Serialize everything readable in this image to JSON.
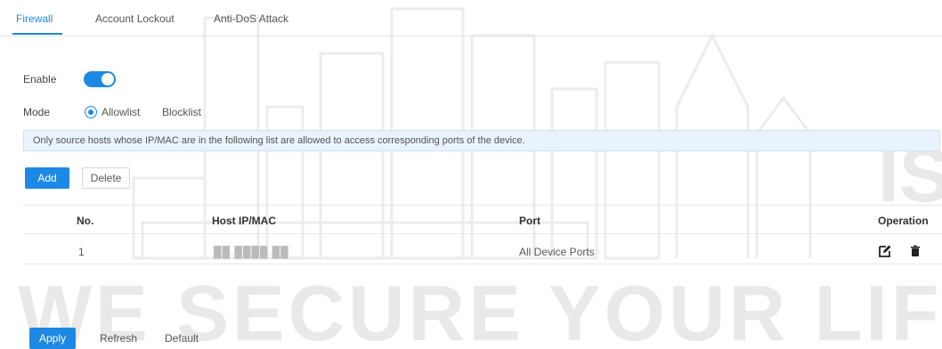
{
  "tabs": [
    {
      "label": "Firewall",
      "active": true
    },
    {
      "label": "Account Lockout",
      "active": false
    },
    {
      "label": "Anti-DoS Attack",
      "active": false
    }
  ],
  "enable": {
    "label": "Enable",
    "on": true
  },
  "mode": {
    "label": "Mode",
    "options": [
      {
        "label": "Allowlist",
        "selected": true
      },
      {
        "label": "Blocklist",
        "selected": false
      }
    ]
  },
  "notice": "Only source hosts whose IP/MAC are in the following list are allowed to access corresponding ports of the device.",
  "toolbar": {
    "add": "Add",
    "delete": "Delete"
  },
  "table": {
    "headers": {
      "no": "No.",
      "host": "Host IP/MAC",
      "port": "Port",
      "operation": "Operation"
    },
    "rows": [
      {
        "no": "1",
        "host": "██.████.██",
        "port": "All Device Ports",
        "icons": [
          "edit-icon",
          "delete-icon"
        ]
      }
    ]
  },
  "footer": {
    "apply": "Apply",
    "refresh": "Refresh",
    "default": "Default"
  },
  "watermark": {
    "text": "WE SECURE YOUR LIFE",
    "side_text": "IS"
  },
  "colors": {
    "accent": "#1e88e5",
    "notice_bg": "#e9f3fd"
  }
}
